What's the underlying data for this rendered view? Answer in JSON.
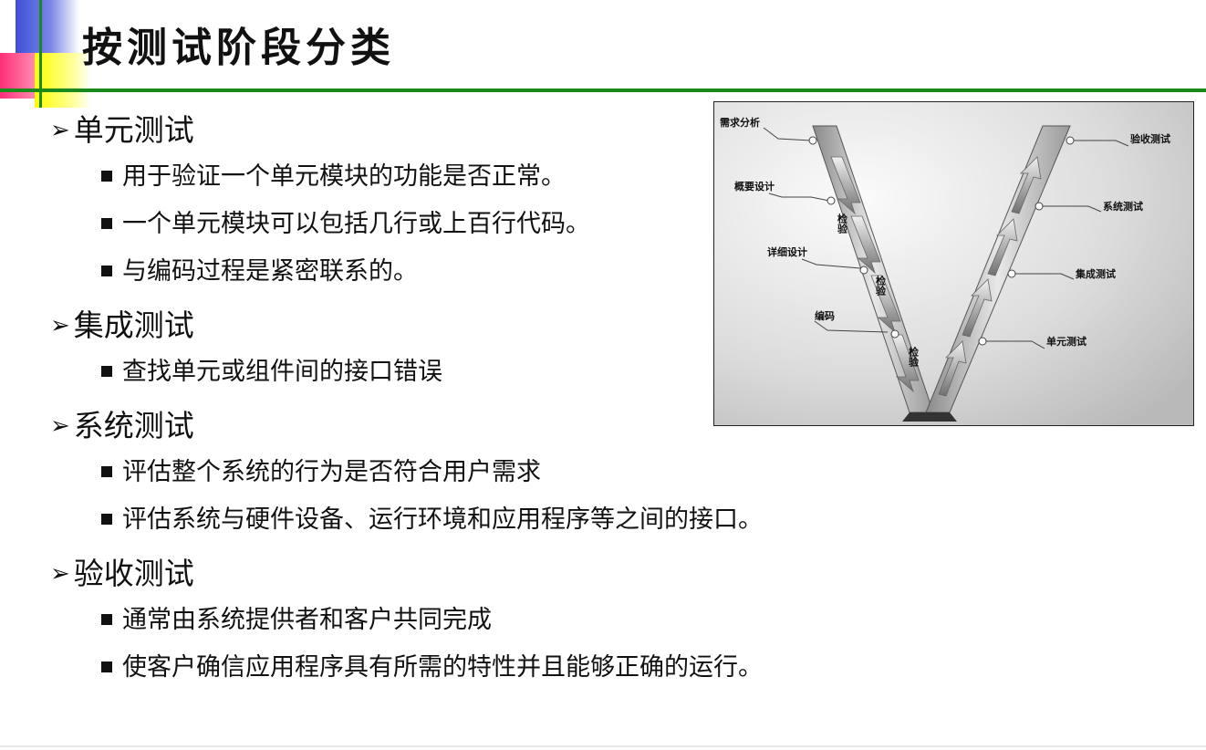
{
  "slide": {
    "title": "按测试阶段分类"
  },
  "sections": [
    {
      "heading": "单元测试",
      "items": [
        "用于验证一个单元模块的功能是否正常。",
        "一个单元模块可以包括几行或上百行代码。",
        "与编码过程是紧密联系的。"
      ]
    },
    {
      "heading": "集成测试",
      "items": [
        "查找单元或组件间的接口错误"
      ]
    },
    {
      "heading": "系统测试",
      "items": [
        "评估整个系统的行为是否符合用户需求",
        "评估系统与硬件设备、运行环境和应用程序等之间的接口。"
      ]
    },
    {
      "heading": "验收测试",
      "items": [
        "通常由系统提供者和客户共同完成",
        "使客户确信应用程序具有所需的特性并且能够正确的运行。"
      ]
    }
  ],
  "vmodel": {
    "left_labels": [
      "需求分析",
      "概要设计",
      "详细设计",
      "编码"
    ],
    "right_labels": [
      "验收测试",
      "系统测试",
      "集成测试",
      "单元测试"
    ],
    "check_label": "检验"
  },
  "colors": {
    "accent_green": "#1a8a1a",
    "deco_blue": "#3d4fd6",
    "deco_pink": "#ff2e7a",
    "deco_yellow": "#ffff00"
  }
}
